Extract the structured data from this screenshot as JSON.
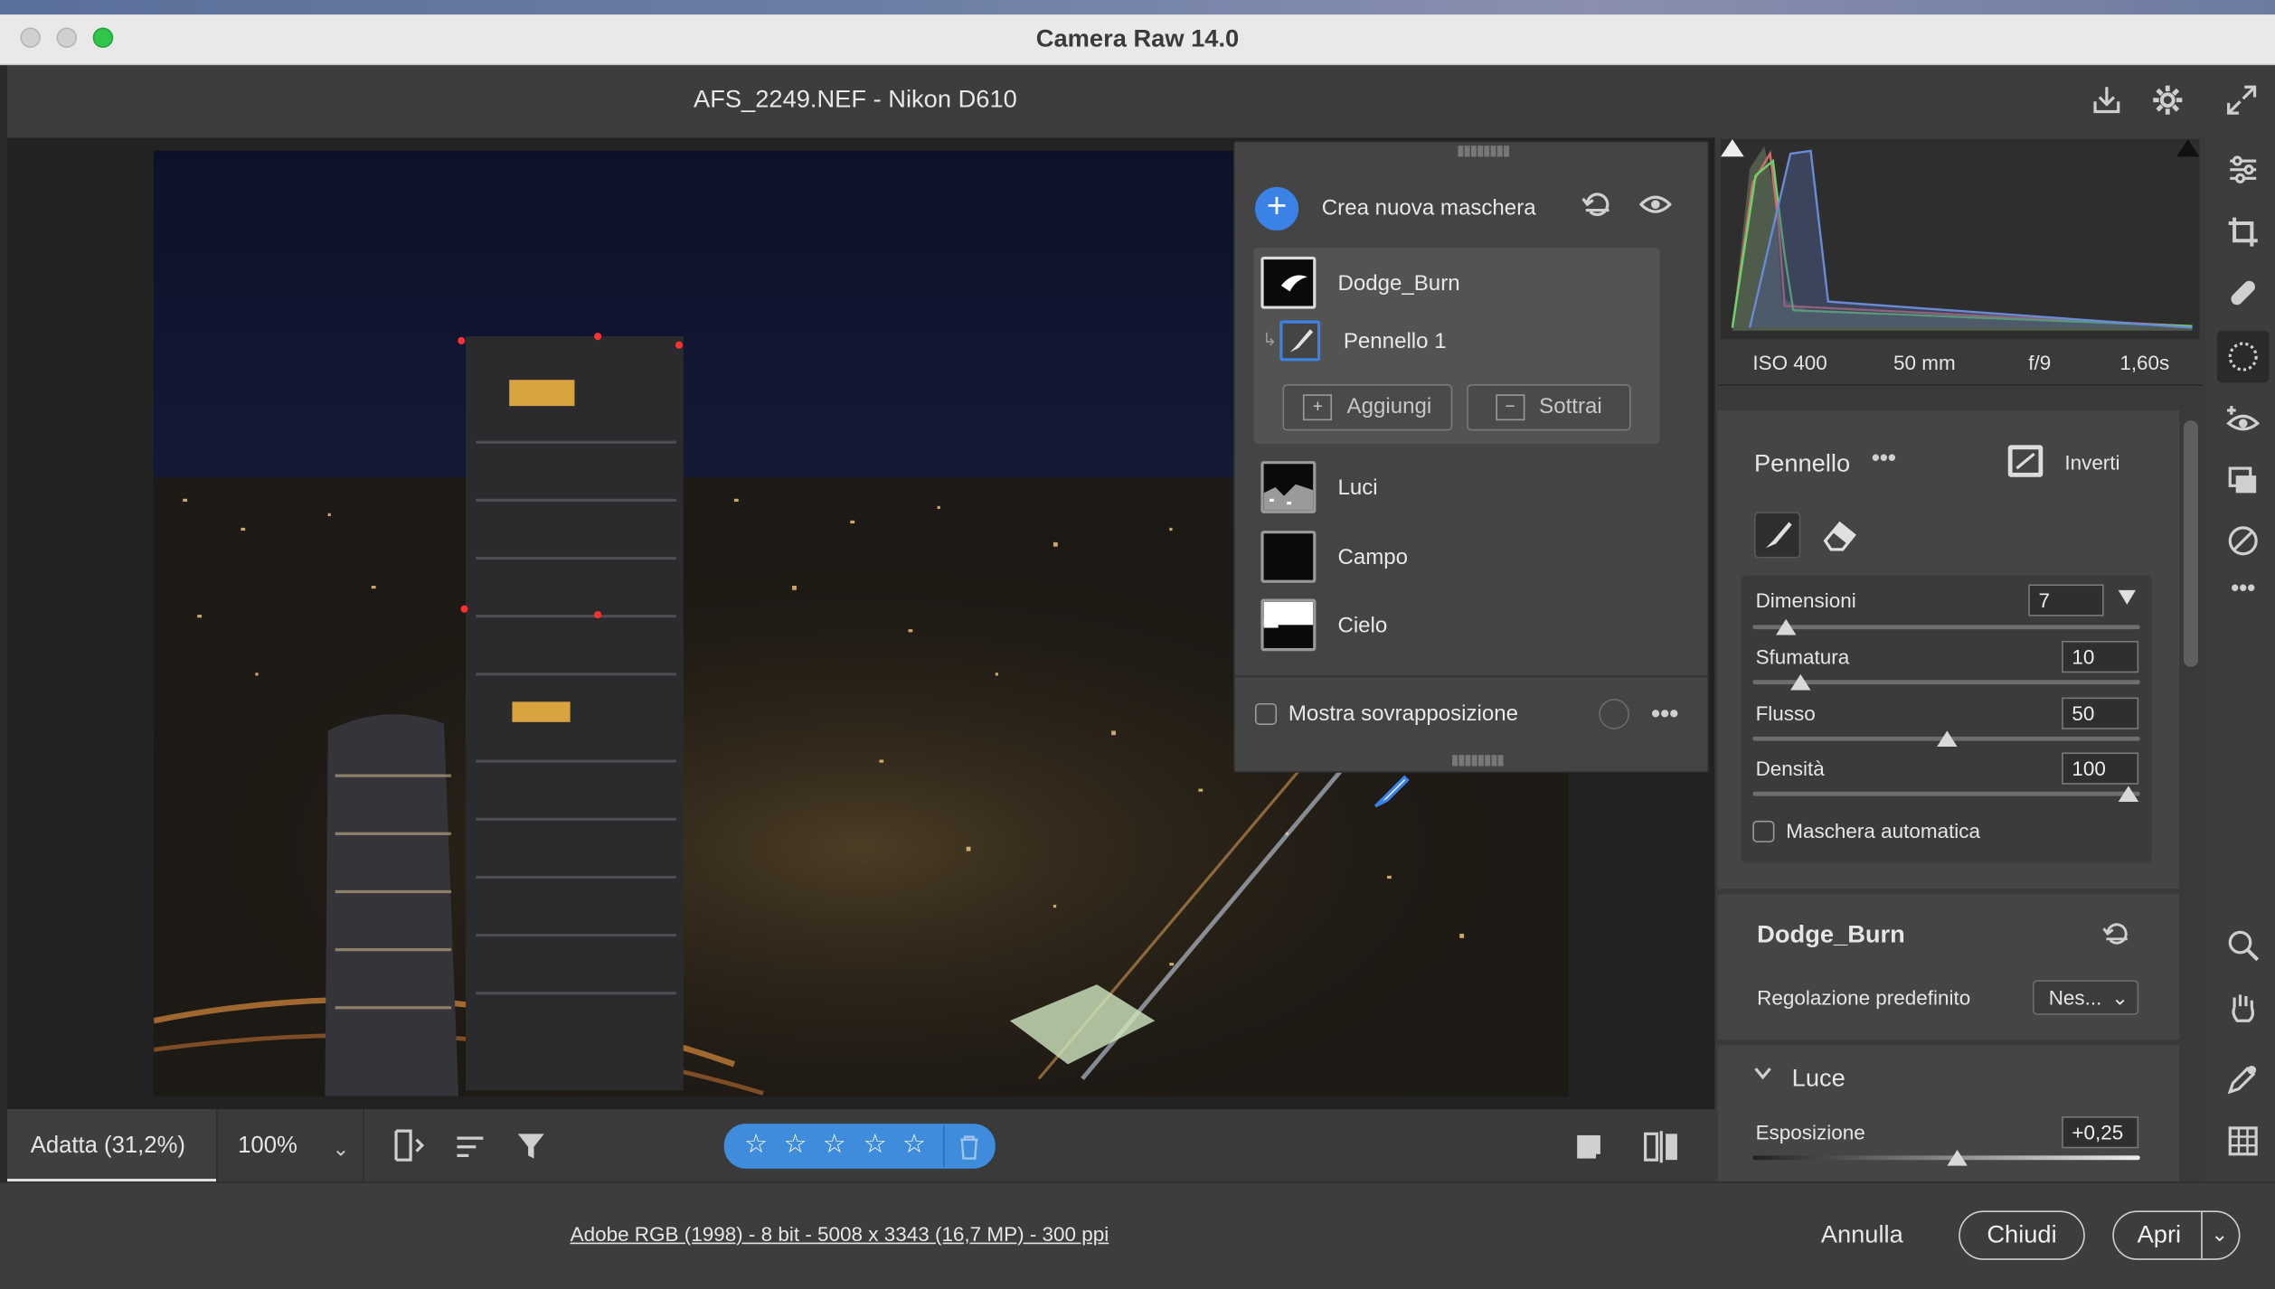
{
  "window": {
    "title": "Camera Raw 14.0"
  },
  "header": {
    "file_info": "AFS_2249.NEF  -  Nikon D610"
  },
  "masks_panel": {
    "create_label": "Crea nuova maschera",
    "masks": [
      {
        "name": "Dodge_Burn",
        "component": "Pennello 1"
      },
      {
        "name": "Luci"
      },
      {
        "name": "Campo"
      },
      {
        "name": "Cielo"
      }
    ],
    "add_label": "Aggiungi",
    "subtract_label": "Sottrai",
    "overlay_label": "Mostra sovrapposizione"
  },
  "exif": {
    "iso": "ISO 400",
    "focal": "50 mm",
    "aperture": "f/9",
    "shutter": "1,60s"
  },
  "brush": {
    "title": "Pennello",
    "invert_label": "Inverti",
    "size_label": "Dimensioni",
    "size_value": "7",
    "size_level": 0.06,
    "feather_label": "Sfumatura",
    "feather_value": "10",
    "feather_level": 0.1,
    "flow_label": "Flusso",
    "flow_value": "50",
    "flow_level": 0.5,
    "density_label": "Densità",
    "density_value": "100",
    "density_level": 1.0,
    "automask_label": "Maschera automatica"
  },
  "adjust": {
    "mask_name": "Dodge_Burn",
    "preset_label": "Regolazione predefinito",
    "preset_value": "Nes...",
    "section_label": "Luce",
    "exposure_label": "Esposizione",
    "exposure_value": "+0,25",
    "exposure_level": 0.53
  },
  "bottom": {
    "fit_label": "Adatta (31,2%)",
    "zoom_label": "100%"
  },
  "footer": {
    "file_specs": "Adobe RGB (1998) - 8 bit - 5008 x 3343 (16,7 MP) - 300 ppi",
    "cancel_label": "Annulla",
    "close_label": "Chiudi",
    "open_label": "Apri"
  },
  "colors": {
    "accent": "#3b82e6",
    "stars_bg": "#3f8bdc",
    "panel": "#3d3d3d"
  },
  "icons": [
    "save-icon",
    "gear-icon",
    "fullscreen-icon",
    "edit-sliders-icon",
    "crop-icon",
    "heal-icon",
    "masking-icon",
    "redeye-icon",
    "snapshots-icon",
    "presets-icon",
    "more-icon",
    "zoom-icon",
    "hand-icon",
    "color-sampler-icon",
    "grid-icon",
    "brush-icon",
    "eraser-icon",
    "invert-icon",
    "reset-icon",
    "eye-icon",
    "star-icon",
    "trash-icon",
    "filter-icon",
    "sort-icon",
    "filmstrip-icon",
    "compare-icon"
  ]
}
